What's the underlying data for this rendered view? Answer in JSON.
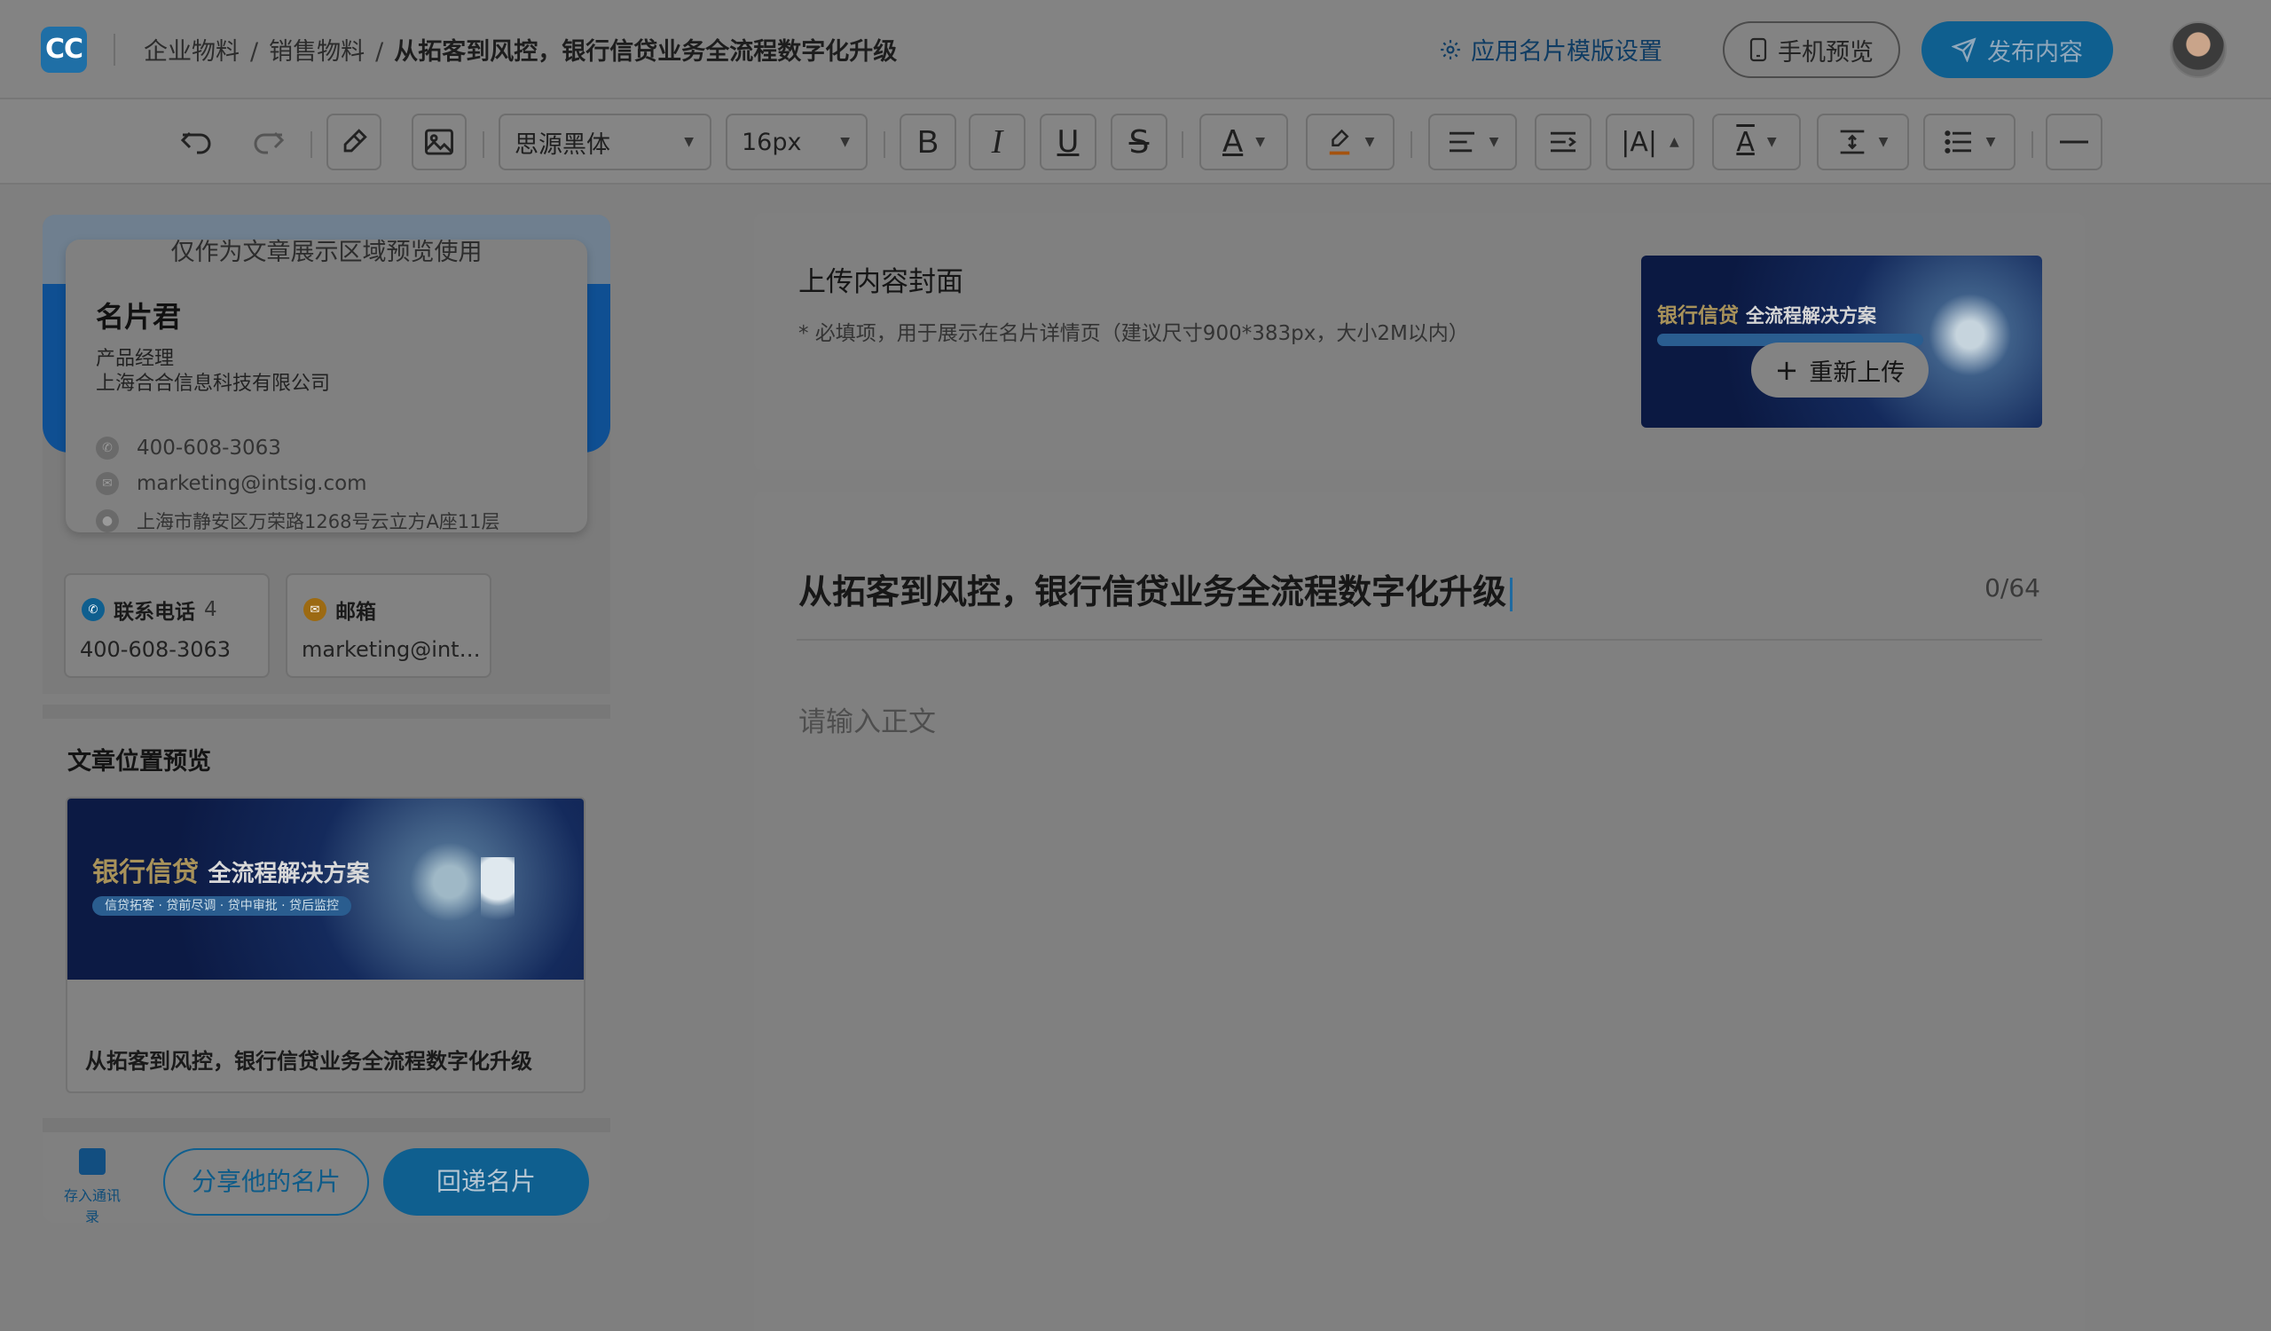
{
  "header": {
    "logo_text": "CC",
    "breadcrumb": [
      "企业物料",
      "销售物料",
      "从拓客到风控，银行信贷业务全流程数字化升级"
    ],
    "template_settings_label": "应用名片模版设置",
    "preview_label": "手机预览",
    "publish_label": "发布内容"
  },
  "toolbar": {
    "font_family": "思源黑体",
    "font_size": "16px",
    "icons": [
      "undo-icon",
      "redo-icon",
      "eraser-icon",
      "image-icon",
      "bold-icon",
      "italic-icon",
      "underline-icon",
      "strikethrough-icon",
      "font-color-icon",
      "highlight-icon",
      "align-icon",
      "indent-icon",
      "letter-spacing-icon",
      "text-baseline-icon",
      "line-height-icon",
      "list-icon",
      "horizontal-rule-icon"
    ]
  },
  "phone": {
    "notice": "仅作为文章展示区域预览使用",
    "card": {
      "name": "名片君",
      "title": "产品经理",
      "company": "上海合合信息科技有限公司",
      "phone": "400-608-3063",
      "email": "marketing@intsig.com",
      "address": "上海市静安区万荣路1268号云立方A座11层"
    },
    "contacts": [
      {
        "label": "联系电话",
        "count": "4",
        "value": "400-608-3063"
      },
      {
        "label": "邮箱",
        "count": "",
        "value": "marketing@intsig.com"
      }
    ],
    "article_section_title": "文章位置预览",
    "banner_title_gold": "银行信贷",
    "banner_title_white": "全流程解决方案",
    "banner_tagline": "信贷拓客 · 贷前尽调 · 贷中审批 · 贷后监控",
    "article_caption": "从拓客到风控，银行信贷业务全流程数字化升级",
    "save_contact_label": "存入通讯录",
    "share_label": "分享他的名片",
    "reply_label": "回递名片"
  },
  "editor": {
    "cover_title": "上传内容封面",
    "cover_hint": "* 必填项，用于展示在名片详情页（建议尺寸900*383px，大小2M以内）",
    "reupload_label": "重新上传",
    "article_title": "从拓客到风控，银行信贷业务全流程数字化升级",
    "title_count": "0/64",
    "body_placeholder": "请输入正文"
  },
  "colors": {
    "brand_blue": "#0f5f8f",
    "overlay_gray": "#7f7f7f"
  }
}
